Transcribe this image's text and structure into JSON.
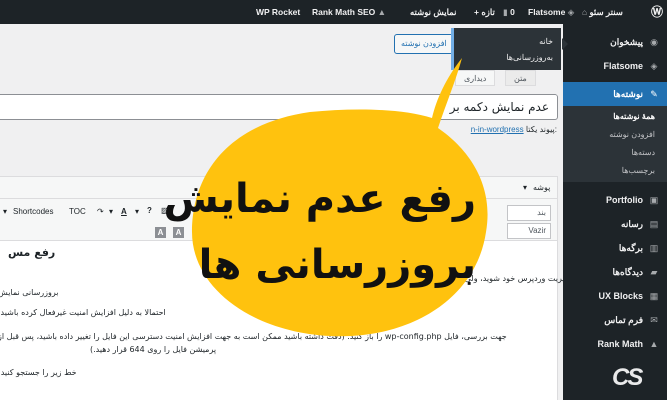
{
  "admin_bar": {
    "wp_logo": "Ⓦ",
    "site_name": "سنتر سئو",
    "flatsome": "Flatsome",
    "comments_count": "0",
    "new_label": "تازه",
    "view_post": "نمایش نوشته",
    "rank_math": "Rank Math SEO",
    "wp_rocket": "WP Rocket"
  },
  "flyout": {
    "items": [
      "خانه",
      "به‌روزرسانی‌ها"
    ]
  },
  "sidebar": {
    "items": [
      {
        "label": "پیشخوان",
        "icon": "dashboard-icon",
        "glyph": "◉"
      },
      {
        "label": "Flatsome",
        "icon": "flatsome-icon",
        "glyph": "◈"
      },
      {
        "label": "نوشته‌ها",
        "icon": "pin-icon",
        "glyph": "✎"
      },
      {
        "label": "Portfolio",
        "icon": "portfolio-icon",
        "glyph": "▣"
      },
      {
        "label": "رسانه",
        "icon": "media-icon",
        "glyph": "▤"
      },
      {
        "label": "برگه‌ها",
        "icon": "pages-icon",
        "glyph": "▥"
      },
      {
        "label": "دیدگاه‌ها",
        "icon": "comments-icon",
        "glyph": "▰"
      },
      {
        "label": "UX Blocks",
        "icon": "blocks-icon",
        "glyph": "▦"
      },
      {
        "label": "فرم تماس",
        "icon": "mail-icon",
        "glyph": "✉"
      },
      {
        "label": "Rank Math",
        "icon": "rankmath-icon",
        "glyph": "▲"
      }
    ],
    "submenu": [
      "همهٔ نوشته‌ها",
      "افزودن نوشته",
      "دسته‌ها",
      "برچسب‌ها"
    ]
  },
  "content": {
    "add_new_button": "افزودن نوشته",
    "title_value": "عدم نمایش دکمه بر",
    "permalink_label": "پیوند یکتا:",
    "permalink_slug": "n-in-wordpress",
    "add_media": "افزودن پرون",
    "tabs": [
      "دیداری",
      "متن"
    ],
    "toolbar": {
      "format": "پوشه",
      "shortcodes": "Shortcodes",
      "toc": "TOC",
      "help": "?",
      "paragraph_select": "بند",
      "font_select": "Vazir"
    },
    "body_heading": "رفع مس",
    "body_lines": [
      "و جهت آپدیت وارد اکانت مدیریت وردپرس خود شوید، ولی مشاه    ممکن است ا",
      "بروزرسانی نمایش",
      "احتمالا به دلیل افزایش امنیت    غیرفعال کرده باشید.",
      "جهت بررسی، فایل wp-config.php را باز کنید. (دقت داشته باشید ممکن است به جهت افزایش امنیت دسترسی این فایل را تغییر داده باشید، پس قبل از",
      "پرمیشن فایل را روی 644 قرار دهید.)",
      "خط زیر را جستجو کنید:"
    ]
  },
  "bubble": {
    "line1": "رفع عدم نمایش",
    "line2": "بروزرسانی ها",
    "color": "#ffc20e"
  },
  "logo": {
    "text": "CS"
  }
}
